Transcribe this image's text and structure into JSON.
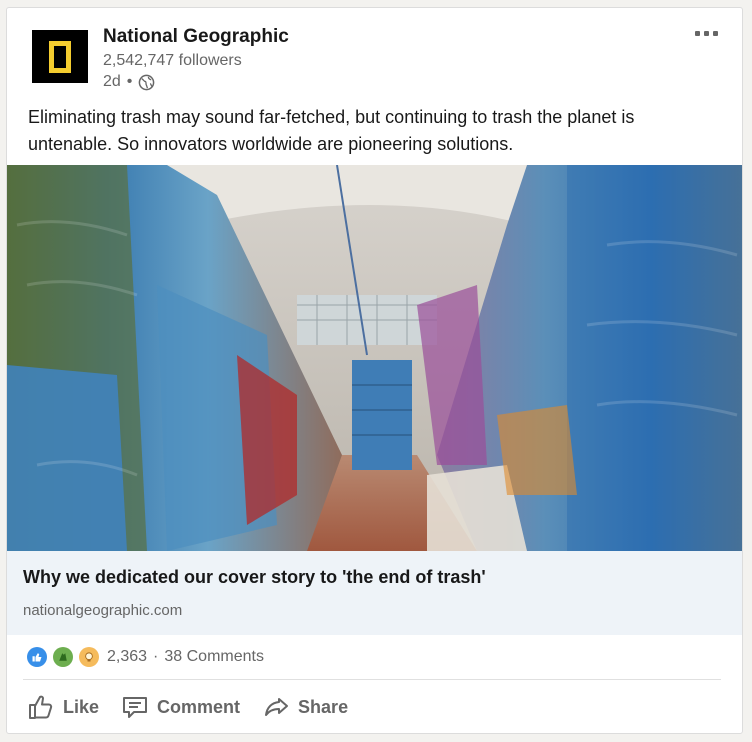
{
  "post": {
    "author_name": "National Geographic",
    "followers": "2,542,747 followers",
    "time": "2d",
    "meta_separator": "•",
    "text": "Eliminating trash may sound far-fetched, but continuing to trash the planet is untenable. So innovators worldwide are pioneering solutions."
  },
  "link_preview": {
    "title": "Why we dedicated our cover story to 'the end of trash'",
    "domain": "nationalgeographic.com"
  },
  "social": {
    "reaction_count": "2,363",
    "separator": "·",
    "comments": "38 Comments"
  },
  "actions": {
    "like": "Like",
    "comment": "Comment",
    "share": "Share"
  },
  "icons": {
    "logo": "national-geographic-logo",
    "globe": "globe-icon",
    "more": "more-options-icon",
    "like_reaction": "like-reaction-icon",
    "celebrate_reaction": "celebrate-reaction-icon",
    "insightful_reaction": "insightful-reaction-icon"
  },
  "colors": {
    "logo_yellow": "#f5cd2f",
    "link_box_bg": "#eef3f8",
    "like_blue": "#378fe9"
  }
}
